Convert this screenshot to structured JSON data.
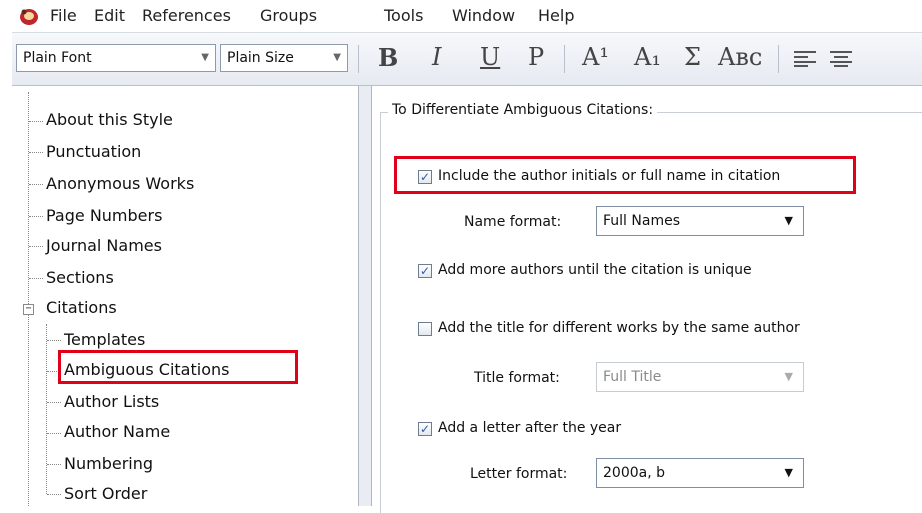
{
  "menu": {
    "items": [
      "File",
      "Edit",
      "References",
      "Groups",
      "Tools",
      "Window",
      "Help"
    ]
  },
  "toolbar": {
    "font_combo": "Plain Font",
    "size_combo": "Plain Size",
    "bold": "B",
    "italic": "I",
    "underline": "U",
    "plain": "P",
    "superscript": "A¹",
    "subscript": "A₁",
    "symbol": "Σ",
    "smallcaps": "Aʙᴄ"
  },
  "tree": {
    "items": [
      "About this Style",
      "Punctuation",
      "Anonymous Works",
      "Page Numbers",
      "Journal Names",
      "Sections",
      "Citations",
      "Templates",
      "Ambiguous Citations",
      "Author Lists",
      "Author Name",
      "Numbering",
      "Sort Order"
    ]
  },
  "panel": {
    "group_title": "To Differentiate Ambiguous Citations:",
    "opt1_label": "Include the author initials or full name in citation",
    "opt1_checked": true,
    "name_format_label": "Name format:",
    "name_format_value": "Full Names",
    "opt2_label": "Add more authors until the citation is unique",
    "opt2_checked": true,
    "opt3_label": "Add the title for different works by the same author",
    "opt3_checked": false,
    "title_format_label": "Title format:",
    "title_format_value": "Full Title",
    "opt4_label": "Add a letter after the year",
    "opt4_checked": true,
    "letter_format_label": "Letter format:",
    "letter_format_value": "2000a, b"
  },
  "colors": {
    "highlight": "#e0001a",
    "check": "#2a5db0"
  }
}
